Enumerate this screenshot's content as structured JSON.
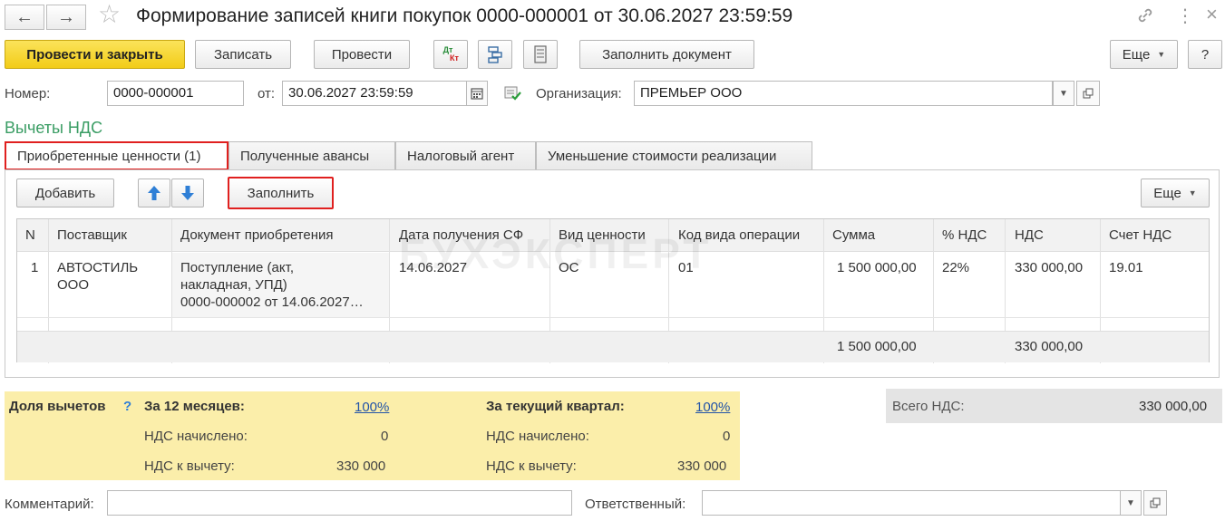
{
  "window": {
    "title": "Формирование записей книги покупок 0000-000001 от 30.06.2027 23:59:59",
    "back_icon": "←",
    "forward_icon": "→",
    "star_icon": "☆",
    "link_icon": "🔗",
    "more_icon": "⋮",
    "close_icon": "×"
  },
  "toolbar": {
    "post_close": "Провести и закрыть",
    "save": "Записать",
    "post": "Провести",
    "dt_kt_top": "Дт",
    "dt_kt_bottom": "Кт",
    "fill_document": "Заполнить документ",
    "more": "Еще",
    "help": "?"
  },
  "header": {
    "number_label": "Номер:",
    "number_value": "0000-000001",
    "date_label": "от:",
    "date_value": "30.06.2027 23:59:59",
    "org_label": "Организация:",
    "org_value": "ПРЕМЬЕР ООО"
  },
  "section_title": "Вычеты НДС",
  "tabs": [
    {
      "label": "Приобретенные ценности (1)"
    },
    {
      "label": "Полученные авансы"
    },
    {
      "label": "Налоговый агент"
    },
    {
      "label": "Уменьшение стоимости реализации"
    }
  ],
  "table_toolbar": {
    "add": "Добавить",
    "fill": "Заполнить",
    "more": "Еще"
  },
  "table": {
    "columns": [
      "N",
      "Поставщик",
      "Документ приобретения",
      "Дата получения СФ",
      "Вид ценности",
      "Код вида операции",
      "Сумма",
      "% НДС",
      "НДС",
      "Счет НДС"
    ],
    "rows": [
      {
        "n": "1",
        "supplier_1": "АВТОСТИЛЬ",
        "supplier_2": "ООО",
        "doc_1": "Поступление (акт,",
        "doc_2": "накладная, УПД)",
        "doc_3": "0000-000002 от 14.06.2027…",
        "date": "14.06.2027",
        "kind": "ОС",
        "code": "01",
        "sum": "1 500 000,00",
        "rate": "22%",
        "vat": "330 000,00",
        "account": "19.01"
      }
    ],
    "totals": {
      "sum": "1 500 000,00",
      "vat": "330 000,00"
    }
  },
  "watermark": "БУХЭКСПЕРТ",
  "deductions": {
    "label": "Доля вычетов",
    "help": "?",
    "months_label": "За 12 месяцев:",
    "months_percent": "100%",
    "quarter_label": "За текущий квартал:",
    "quarter_percent": "100%",
    "accrued_label": "НДС начислено:",
    "deductible_label": "НДС к вычету:",
    "months_accrued": "0",
    "months_deductible": "330 000",
    "quarter_accrued": "0",
    "quarter_deductible": "330 000",
    "total_label": "Всего НДС:",
    "total_value": "330 000,00"
  },
  "footer": {
    "comment_label": "Комментарий:",
    "comment_value": "",
    "responsible_label": "Ответственный:",
    "responsible_value": ""
  },
  "colors": {
    "primary": "#f2cc18",
    "section_title": "#3a9d64",
    "highlight": "#e0201f",
    "arrow": "#2f7fd6",
    "summary_bg": "#fbeeaa"
  }
}
